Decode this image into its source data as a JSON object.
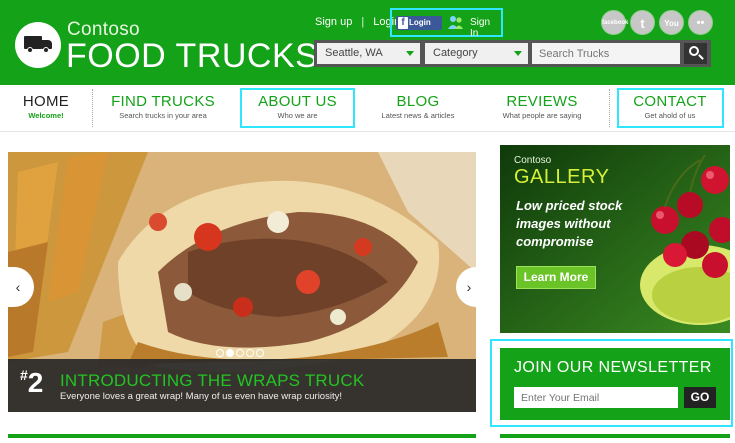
{
  "brand": {
    "name_small": "Contoso",
    "name_big": "FOOD TRUCKS",
    "primary_color": "#14a218",
    "highlight_color": "#2ee6ff"
  },
  "top_links": {
    "signup": "Sign up",
    "separator": "|",
    "login": "Login",
    "facebook_login": "Login",
    "facebook_letter": "f",
    "sign_in": "Sign In"
  },
  "social": [
    {
      "icon": "facebook-icon",
      "label": "facebook"
    },
    {
      "icon": "twitter-icon",
      "label": "t"
    },
    {
      "icon": "youtube-icon",
      "label": "You"
    },
    {
      "icon": "flickr-icon",
      "label": "••"
    }
  ],
  "search": {
    "location": "Seattle, WA",
    "category": "Category",
    "placeholder": "Search Trucks"
  },
  "nav": [
    {
      "title": "HOME",
      "sub": "Welcome!"
    },
    {
      "title": "FIND TRUCKS",
      "sub": "Search trucks in your area"
    },
    {
      "title": "ABOUT US",
      "sub": "Who we are"
    },
    {
      "title": "BLOG",
      "sub": "Latest news & articles"
    },
    {
      "title": "REVIEWS",
      "sub": "What people are saying"
    },
    {
      "title": "CONTACT",
      "sub": "Get ahold of us"
    }
  ],
  "hero": {
    "number_hash": "#",
    "number": "2",
    "title": "INTRODUCTING THE WRAPS TRUCK",
    "subtitle": "Everyone loves a great wrap!  Many of us even have wrap curiosity!",
    "prev": "‹",
    "next": "›",
    "slide_count": 5,
    "active_slide": 2
  },
  "ad": {
    "brand": "Contoso",
    "title": "GALLERY",
    "tagline": "Low priced stock images without compromise",
    "button": "Learn More"
  },
  "newsletter": {
    "title": "JOIN OUR NEWSLETTER",
    "placeholder": "Enter Your Email",
    "button": "GO"
  }
}
